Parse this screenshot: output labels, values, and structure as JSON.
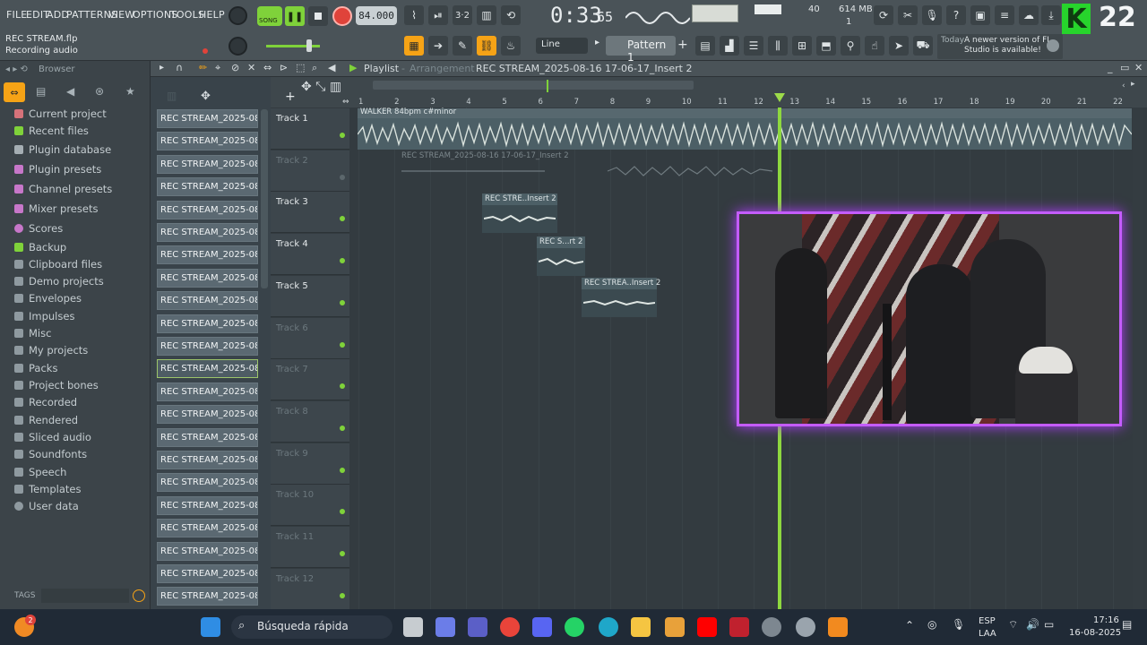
{
  "menu": [
    "FILE",
    "EDIT",
    "ADD",
    "PATTERNS",
    "VIEW",
    "OPTIONS",
    "TOOLS",
    "HELP"
  ],
  "transport": {
    "song_label": "SONG",
    "tempo": "84.000",
    "time": "0:33",
    "time_frac": "65",
    "cpu_value": "40",
    "memory": "614 MB",
    "voices": "1"
  },
  "project": {
    "file": "REC STREAM.flp",
    "status": "Recording audio"
  },
  "toolbar": {
    "snap": "Line",
    "pattern": "Pattern 1"
  },
  "news": {
    "label": "Today",
    "text": "A newer version of FL Studio is available!"
  },
  "overlay_badge": {
    "number": "22"
  },
  "browser": {
    "title": "Browser",
    "items": [
      "Current project",
      "Recent files",
      "Plugin database",
      "Plugin presets",
      "Channel presets",
      "Mixer presets",
      "Scores",
      "Backup",
      "Clipboard files",
      "Demo projects",
      "Envelopes",
      "Impulses",
      "Misc",
      "My projects",
      "Packs",
      "Project bones",
      "Recorded",
      "Rendered",
      "Sliced audio",
      "Soundfonts",
      "Speech",
      "Templates",
      "User data"
    ],
    "tags_label": "TAGS"
  },
  "channels": {
    "item_label": "REC STREAM_2025-08-16...",
    "count": 22
  },
  "playlist": {
    "title": "Playlist",
    "subtitle": "Arrangement",
    "pattern_name": "REC STREAM_2025-08-16 17-06-17_Insert 2",
    "tracks": [
      "Track 1",
      "Track 2",
      "Track 3",
      "Track 4",
      "Track 5",
      "Track 6",
      "Track 7",
      "Track 8",
      "Track 9",
      "Track 10",
      "Track 11",
      "Track 12"
    ],
    "bars": [
      "1",
      "2",
      "3",
      "4",
      "5",
      "6",
      "7",
      "8",
      "9",
      "10",
      "11",
      "12",
      "13",
      "14",
      "15",
      "16",
      "17",
      "18",
      "19",
      "20",
      "21",
      "22"
    ],
    "clips": {
      "main": "WALKER 84bpm c#minor",
      "rec_full": "REC STREAM_2025-08-16 17-06-17_Insert 2",
      "clip3": "REC STRE..Insert 2",
      "clip4": "REC S...rt 2",
      "clip5": "REC STREA..Insert 2"
    }
  },
  "taskbar": {
    "search": "Búsqueda rápida",
    "lang1": "ESP",
    "lang2": "LAA",
    "time": "17:16",
    "date": "16-08-2025",
    "notif_count": "2"
  },
  "colors": {
    "accent_green": "#7fd23a",
    "record_red": "#e0433a",
    "overlay_purple": "#b23cff"
  }
}
